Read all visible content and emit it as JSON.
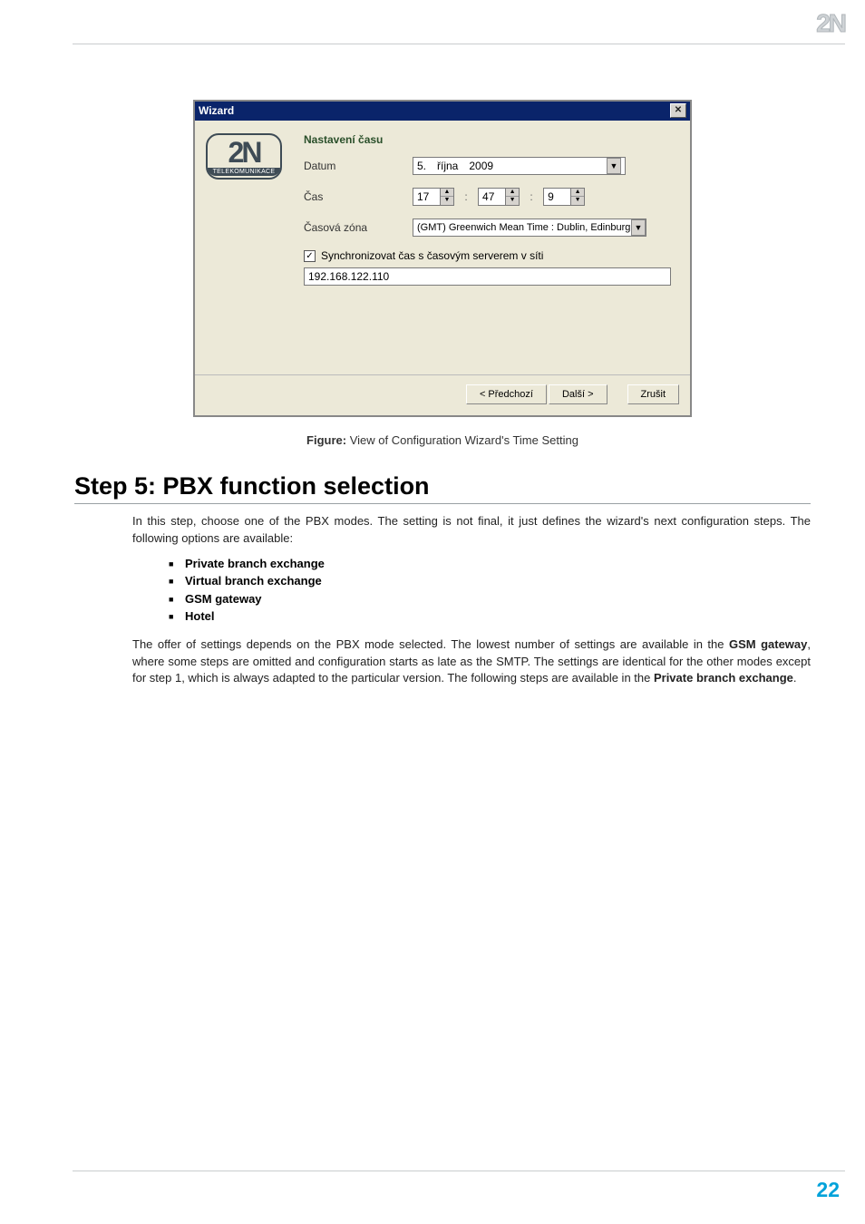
{
  "page": {
    "logo": "2N",
    "number": "22"
  },
  "caption": {
    "bold": "Figure:",
    "text": " View of Configuration Wizard's Time Setting"
  },
  "wizard": {
    "title": "Wizard",
    "brand_top": "2N",
    "brand_bottom": "TELEKOMUNIKACE",
    "heading": "Nastavení času",
    "labels": {
      "date": "Datum",
      "time": "Čas",
      "tz": "Časová zóna"
    },
    "date": {
      "day": "5.",
      "month": "října",
      "year": "2009"
    },
    "time": {
      "h": "17",
      "m": "47",
      "s": "9"
    },
    "tz_value": "(GMT) Greenwich Mean Time : Dublin, Edinburg",
    "sync_label": "Synchronizovat čas s časovým serverem v síti",
    "sync_checked": "✓",
    "ip": "192.168.122.110",
    "buttons": {
      "prev": "< Předchozí",
      "next": "Další >",
      "cancel": "Zrušit"
    }
  },
  "section": {
    "heading": "Step 5: PBX function selection",
    "para1": "In this step, choose one of the PBX modes. The setting is not final, it just defines the wizard's next configuration steps. The following options are available:",
    "options": {
      "o1": "Private branch exchange",
      "o2": "Virtual branch exchange",
      "o3": "GSM gateway",
      "o4": "Hotel"
    },
    "para2_a": "The offer of settings depends on the PBX mode selected. The lowest number of settings are available in the ",
    "para2_b": "GSM gateway",
    "para2_c": ", where some steps are omitted and configuration starts as late as the SMTP. The settings are identical for the other modes except for step 1, which is always adapted to the particular version. The following steps are available in the ",
    "para2_d": "Private branch exchange",
    "para2_e": "."
  }
}
